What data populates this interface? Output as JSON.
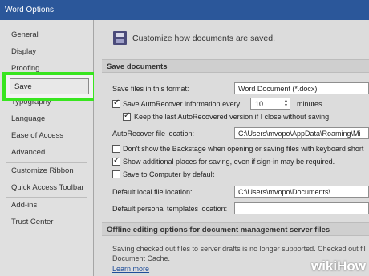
{
  "window": {
    "title": "Word Options"
  },
  "sidebar": {
    "items": [
      {
        "label": "General"
      },
      {
        "label": "Display"
      },
      {
        "label": "Proofing"
      },
      {
        "label": "Save",
        "selected": true
      },
      {
        "label": "Typography"
      },
      {
        "label": "Language"
      },
      {
        "label": "Ease of Access"
      },
      {
        "label": "Advanced"
      },
      {
        "label": "Customize Ribbon"
      },
      {
        "label": "Quick Access Toolbar"
      },
      {
        "label": "Add-ins"
      },
      {
        "label": "Trust Center"
      }
    ]
  },
  "main": {
    "header": "Customize how documents are saved.",
    "icon": "floppy-disk-icon",
    "save_documents": {
      "section_title": "Save documents",
      "format_label": "Save files in this format:",
      "format_value": "Word Document (*.docx)",
      "autorecover_label": "Save AutoRecover information every",
      "autorecover_checked": true,
      "autorecover_minutes": "10",
      "minutes_label": "minutes",
      "keep_last_label": "Keep the last AutoRecovered version if I close without saving",
      "keep_last_checked": true,
      "autorecover_location_label": "AutoRecover file location:",
      "autorecover_location_value": "C:\\Users\\mvopo\\AppData\\Roaming\\Mi",
      "no_backstage_label": "Don't show the Backstage when opening or saving files with keyboard short",
      "no_backstage_checked": false,
      "additional_places_label": "Show additional places for saving, even if sign-in may be required.",
      "additional_places_checked": true,
      "save_to_computer_label": "Save to Computer by default",
      "save_to_computer_checked": false,
      "default_local_label": "Default local file location:",
      "default_local_value": "C:\\Users\\mvopo\\Documents\\",
      "default_templates_label": "Default personal templates location:",
      "default_templates_value": ""
    },
    "offline": {
      "section_title": "Offline editing options for document management server files",
      "description_line1": "Saving checked out files to server drafts is no longer supported. Checked out fil",
      "description_line2": "Document Cache.",
      "learn_more": "Learn more"
    }
  },
  "watermark": {
    "wiki": "wiki",
    "how": "How"
  },
  "colors": {
    "title_bar": "#2b579a",
    "highlight": "#38e51f"
  }
}
